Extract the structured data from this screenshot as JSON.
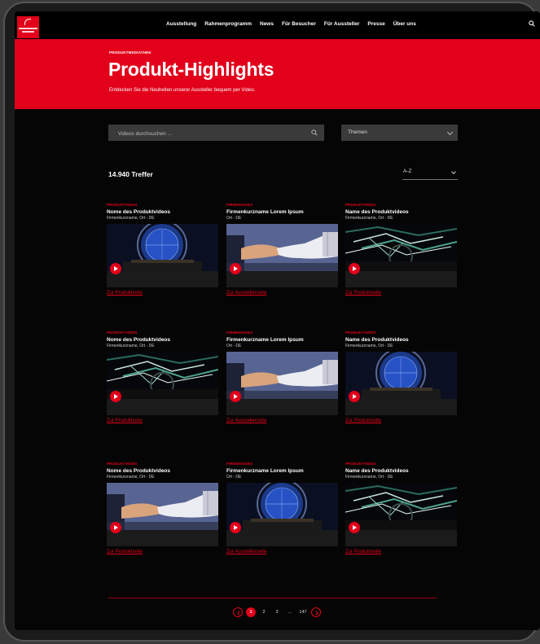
{
  "nav": {
    "links": [
      "Ausstellung",
      "Rahmenprogramm",
      "News",
      "Für Besucher",
      "Für Aussteller",
      "Presse",
      "Über uns"
    ]
  },
  "hero": {
    "eyebrow": "PRODUKTMEDIATHEK",
    "title": "Produkt-Highlights",
    "subtitle": "Entdecken Sie die Neuheiten unserer Aussteller bequem per Video."
  },
  "search": {
    "placeholder": "Videos durchsuchen ..."
  },
  "topic_filter": {
    "value": "Themen"
  },
  "results": {
    "count": "14.940 Treffer"
  },
  "sort": {
    "value": "A-Z"
  },
  "cards": [
    {
      "category": "PRODUKTVIDEO",
      "title": "Nome des Produktvideos",
      "sub": "Firmenkurzname, Ort - DE",
      "link": "Zur Produktseite",
      "thumb": "circle"
    },
    {
      "category": "FIRMENVIDEO",
      "title": "Firmenkurzname Lorem Ipsum",
      "sub": "Ort - DE",
      "link": "Zur Ausstellerseite",
      "thumb": "hands"
    },
    {
      "category": "PRODUKTVIDEO",
      "title": "Name des Produktvideos",
      "sub": "Firmenkurzname, Ort - DE",
      "link": "Zur Produktseite",
      "thumb": "lines"
    },
    {
      "category": "PRODUKTVIDEO",
      "title": "Nome des Produktvideos",
      "sub": "Firmenkurzname, Ort - DE",
      "link": "Zur Produktseite",
      "thumb": "lines"
    },
    {
      "category": "FIRMENVIDEO",
      "title": "Firmenkurzname Lorem Ipsum",
      "sub": "Ort - DE",
      "link": "Zur Ausstellerseite",
      "thumb": "hands"
    },
    {
      "category": "PRODUKTVIDEO",
      "title": "Name des Produktvideos",
      "sub": "Firmenkurzname, Ort - DE",
      "link": "Zur Produktseite",
      "thumb": "circle"
    },
    {
      "category": "PRODUKTVIDEO",
      "title": "Nome des Produktvideos",
      "sub": "Firmenkurzname, Ort - DE",
      "link": "Zur Produktseite",
      "thumb": "hands"
    },
    {
      "category": "FIRMENVIDEO",
      "title": "Firmenkurzname Lorem Ipsum",
      "sub": "Ort - DE",
      "link": "Zur Ausstellerseite",
      "thumb": "circle"
    },
    {
      "category": "PRODUKTVIDEO",
      "title": "Name des Produktvideos",
      "sub": "Firmenkurzname, Ort - DE",
      "link": "Zur Produktseite",
      "thumb": "lines"
    }
  ],
  "pagination": {
    "pages": [
      "1",
      "2",
      "3",
      "...",
      "147"
    ],
    "active": "1"
  },
  "colors": {
    "brand_red": "#e2001a",
    "background": "#050505"
  },
  "icons": {
    "search": "search-icon",
    "play": "play-icon",
    "chevron": "chevron-down-icon",
    "prev": "chevron-left-icon",
    "next": "chevron-right-icon"
  }
}
